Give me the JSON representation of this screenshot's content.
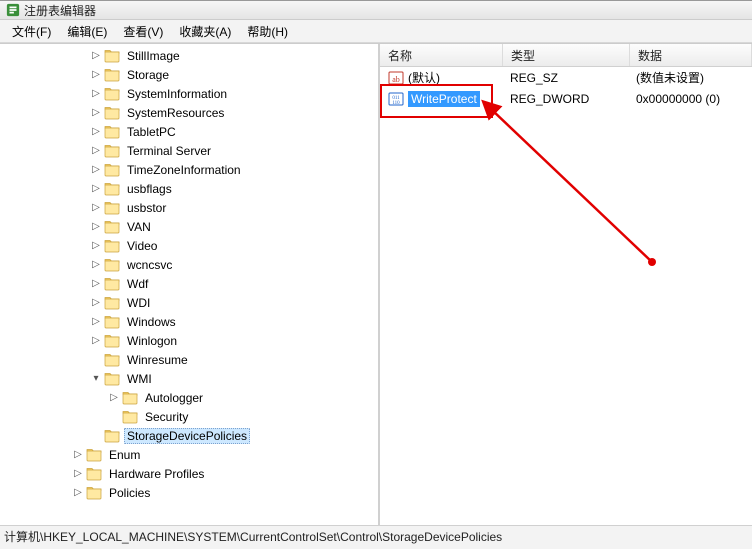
{
  "window": {
    "title": "注册表编辑器"
  },
  "menubar": [
    {
      "label": "文件(F)"
    },
    {
      "label": "编辑(E)"
    },
    {
      "label": "查看(V)"
    },
    {
      "label": "收藏夹(A)"
    },
    {
      "label": "帮助(H)"
    }
  ],
  "tree": [
    {
      "indent": 5,
      "toggle": ">",
      "label": "StillImage"
    },
    {
      "indent": 5,
      "toggle": ">",
      "label": "Storage"
    },
    {
      "indent": 5,
      "toggle": ">",
      "label": "SystemInformation"
    },
    {
      "indent": 5,
      "toggle": ">",
      "label": "SystemResources"
    },
    {
      "indent": 5,
      "toggle": ">",
      "label": "TabletPC"
    },
    {
      "indent": 5,
      "toggle": ">",
      "label": "Terminal Server"
    },
    {
      "indent": 5,
      "toggle": ">",
      "label": "TimeZoneInformation"
    },
    {
      "indent": 5,
      "toggle": ">",
      "label": "usbflags"
    },
    {
      "indent": 5,
      "toggle": ">",
      "label": "usbstor"
    },
    {
      "indent": 5,
      "toggle": ">",
      "label": "VAN"
    },
    {
      "indent": 5,
      "toggle": ">",
      "label": "Video"
    },
    {
      "indent": 5,
      "toggle": ">",
      "label": "wcncsvc"
    },
    {
      "indent": 5,
      "toggle": ">",
      "label": "Wdf"
    },
    {
      "indent": 5,
      "toggle": ">",
      "label": "WDI"
    },
    {
      "indent": 5,
      "toggle": ">",
      "label": "Windows"
    },
    {
      "indent": 5,
      "toggle": ">",
      "label": "Winlogon"
    },
    {
      "indent": 5,
      "toggle": "",
      "label": "Winresume"
    },
    {
      "indent": 5,
      "toggle": "v",
      "label": "WMI"
    },
    {
      "indent": 6,
      "toggle": ">",
      "label": "Autologger"
    },
    {
      "indent": 6,
      "toggle": "",
      "label": "Security"
    },
    {
      "indent": 5,
      "toggle": "",
      "label": "StorageDevicePolicies",
      "selected": true
    },
    {
      "indent": 4,
      "toggle": ">",
      "label": "Enum"
    },
    {
      "indent": 4,
      "toggle": ">",
      "label": "Hardware Profiles"
    },
    {
      "indent": 4,
      "toggle": ">",
      "label": "Policies"
    }
  ],
  "columns": {
    "name": "名称",
    "type": "类型",
    "data": "数据"
  },
  "values": [
    {
      "icon": "string",
      "name": "(默认)",
      "type": "REG_SZ",
      "data": "(数值未设置)",
      "selected": false
    },
    {
      "icon": "binary",
      "name": "WriteProtect",
      "type": "REG_DWORD",
      "data": "0x00000000 (0)",
      "selected": true
    }
  ],
  "statusbar": "计算机\\HKEY_LOCAL_MACHINE\\SYSTEM\\CurrentControlSet\\Control\\StorageDevicePolicies"
}
